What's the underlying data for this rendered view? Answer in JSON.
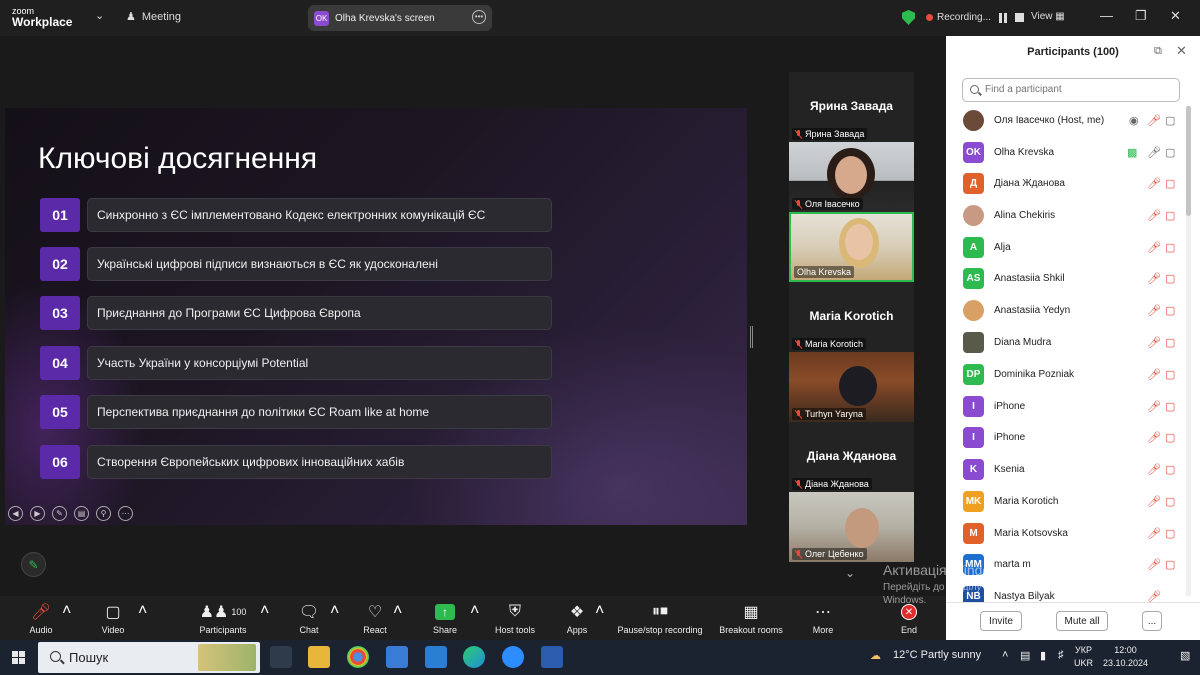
{
  "topbar": {
    "logo_line1": "zoom",
    "logo_line2": "Workplace",
    "meeting_label": "Meeting",
    "screen_avatar": "OK",
    "screen_label": "Olha Krevska's screen",
    "recording_label": "Recording...",
    "view_label": "View"
  },
  "slide": {
    "title": "Ключові досягнення",
    "items": [
      {
        "num": "01",
        "text": "Синхронно з ЄС імплементовано Кодекс електронних комунікацій ЄС"
      },
      {
        "num": "02",
        "text": "Українські цифрові підписи визнаються в ЄС як удосконалені"
      },
      {
        "num": "03",
        "text": "Приєднання до Програми ЄС Цифрова Європа"
      },
      {
        "num": "04",
        "text": "Участь України у консорціумі Potential"
      },
      {
        "num": "05",
        "text": "Перспектива приєднання до політики ЄС Roam like at home"
      },
      {
        "num": "06",
        "text": "Створення Європейських цифрових інноваційних хабів"
      }
    ]
  },
  "videos": {
    "tile1_big": "Ярина Завада",
    "tile1_name": "Ярина Завада",
    "tile2_name": "Оля Івасечко",
    "tile3_name": "Olha Krevska",
    "tile4_big": "Maria Korotich",
    "tile4_name": "Maria Korotich",
    "tile5_name": "Turhyn Yaryna",
    "tile6_big": "Діана Жданова",
    "tile6_name": "Діана Жданова",
    "tile7_name": "Олег Цебенко"
  },
  "watermark": {
    "line1": "Активація Windows",
    "line2": "Перейдіть до розділу \"Настройки\", щоб активувати",
    "line3": "Windows."
  },
  "participants": {
    "title": "Participants (100)",
    "search_placeholder": "Find a participant",
    "list": [
      {
        "initials": "",
        "name": "Оля Івасечко (Host, me)",
        "color": "#6b4a3a"
      },
      {
        "initials": "OK",
        "name": "Olha Krevska",
        "color": "#8a4bd1"
      },
      {
        "initials": "Д",
        "name": "Діана Жданова",
        "color": "#e0622a"
      },
      {
        "initials": "",
        "name": "Alina Chekiris",
        "color": "#c89a84"
      },
      {
        "initials": "A",
        "name": "Alja",
        "color": "#2dbb4f"
      },
      {
        "initials": "AS",
        "name": "Anastasiia Shkil",
        "color": "#2dbb4f"
      },
      {
        "initials": "",
        "name": "Anastasiia Yedyn",
        "color": "#d9a066"
      },
      {
        "initials": "",
        "name": "Diana Mudra",
        "color": "#5a5a4a"
      },
      {
        "initials": "DP",
        "name": "Dominika Pozniak",
        "color": "#2dbb4f"
      },
      {
        "initials": "I",
        "name": "iPhone",
        "color": "#8a4bd1"
      },
      {
        "initials": "I",
        "name": "iPhone",
        "color": "#8a4bd1"
      },
      {
        "initials": "K",
        "name": "Ksenia",
        "color": "#8a4bd1"
      },
      {
        "initials": "MK",
        "name": "Maria Korotich",
        "color": "#f0a020"
      },
      {
        "initials": "M",
        "name": "Maria Kotsovska",
        "color": "#e0622a"
      },
      {
        "initials": "MM",
        "name": "marta m",
        "color": "#1f6fd1"
      },
      {
        "initials": "NB",
        "name": "Nastya Bilyak",
        "color": "#1f4fa1"
      }
    ],
    "invite_label": "Invite",
    "mute_all_label": "Mute all",
    "more_label": "..."
  },
  "toolbar": {
    "audio": "Audio",
    "video": "Video",
    "participants": "Participants",
    "participants_count": "100",
    "chat": "Chat",
    "react": "React",
    "share": "Share",
    "host_tools": "Host tools",
    "apps": "Apps",
    "pause_stop": "Pause/stop recording",
    "breakout": "Breakout rooms",
    "more": "More",
    "end": "End"
  },
  "taskbar": {
    "search_label": "Пошук",
    "weather": "12°C  Partly sunny",
    "lang1": "УКР",
    "lang2": "UKR",
    "time": "12:00",
    "date": "23.10.2024"
  },
  "colors": {
    "accent_purple": "#5b2aa8",
    "zoom_green": "#2dbb4f",
    "end_red": "#e02b2b"
  }
}
